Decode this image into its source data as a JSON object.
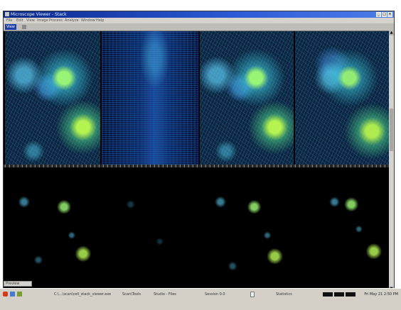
{
  "window": {
    "title": "Microscope Viewer - Stack",
    "menu": [
      "File",
      "Edit",
      "View",
      "Image",
      "Process",
      "Analyze",
      "Window",
      "Help"
    ],
    "toolbar_tag": "View",
    "preview_tab": "Preview"
  },
  "panels": {
    "top": [
      "raw-channel-1",
      "kymograph",
      "raw-channel-2",
      "raw-channel-3"
    ],
    "bottom": [
      "spots-1",
      "spots-2",
      "spots-3",
      "spots-4"
    ]
  },
  "taskbar": {
    "items": [
      "start",
      "C:\\...\\scan\\cell_stack_viewer.exe",
      "Scan\\Tools",
      "Studio - Files",
      "Session 0.0",
      "Statistics"
    ],
    "clock": "Fri May 21  2:50 PM"
  },
  "colors": {
    "accent": "#2d5ad6",
    "glow_cyan": "#3fd0e8",
    "glow_green": "#9dff5a"
  }
}
